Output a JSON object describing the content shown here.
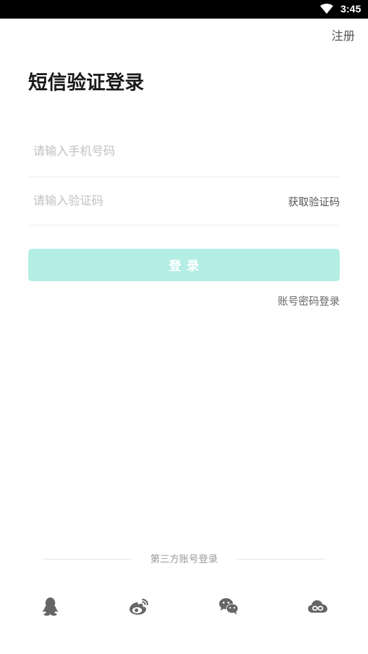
{
  "status_bar": {
    "time": "3:45"
  },
  "header": {
    "register_label": "注册"
  },
  "page": {
    "title": "短信验证登录"
  },
  "form": {
    "phone_placeholder": "请输入手机号码",
    "phone_value": "",
    "code_placeholder": "请输入验证码",
    "code_value": "",
    "get_code_label": "获取验证码",
    "login_label": "登录",
    "password_login_label": "账号密码登录"
  },
  "third_party": {
    "label": "第三方账号登录",
    "providers": [
      {
        "icon": "qq-icon"
      },
      {
        "icon": "weibo-icon"
      },
      {
        "icon": "wechat-icon"
      },
      {
        "icon": "cloud-link-icon"
      }
    ]
  },
  "colors": {
    "login_button_bg": "#b3ede4",
    "icon_gray": "#666666",
    "status_bar_bg": "#000000"
  }
}
